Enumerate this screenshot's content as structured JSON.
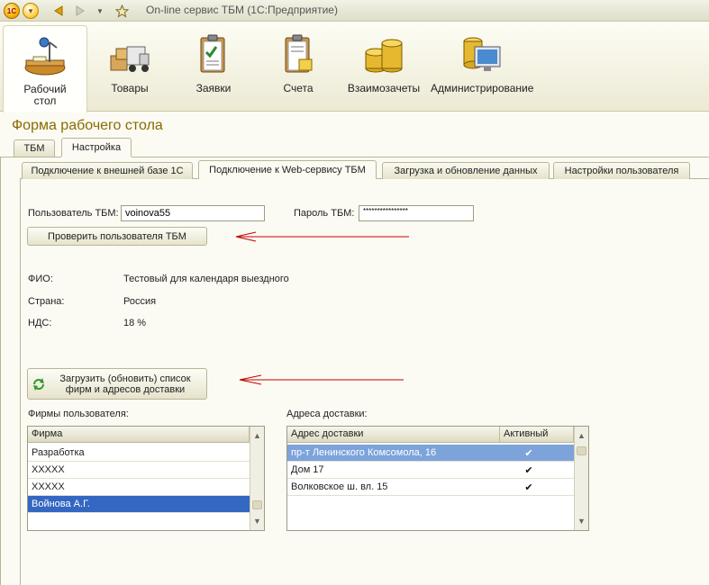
{
  "titlebar": {
    "title": "On-line сервис ТБМ  (1С:Предприятие)",
    "logo": "1С",
    "icons": [
      "1c-logo-icon",
      "main-menu-icon",
      "back-arrow-icon",
      "forward-arrow-icon",
      "dropdown-icon",
      "favorite-star-icon"
    ]
  },
  "sections": [
    {
      "label": "Рабочий\nстол",
      "icon": "desktop-icon"
    },
    {
      "label": "Товары",
      "icon": "goods-truck-icon"
    },
    {
      "label": "Заявки",
      "icon": "orders-clipboard-icon"
    },
    {
      "label": "Счета",
      "icon": "invoices-clipboard-icon"
    },
    {
      "label": "Взаимозачеты",
      "icon": "coins-icon"
    },
    {
      "label": "Администрирование",
      "icon": "monitor-database-icon"
    }
  ],
  "form": {
    "title": "Форма рабочего стола",
    "tabs": [
      "ТБМ",
      "Настройка"
    ],
    "subtabs": [
      "Подключение к внешней базе 1С",
      "Подключение к Web-сервису ТБМ",
      "Загрузка и обновление данных",
      "Настройки пользователя"
    ]
  },
  "connection": {
    "user_label": "Пользователь ТБМ:",
    "user_value": "voinova55",
    "password_label": "Пароль ТБМ:",
    "password_value": "****************",
    "check_button": "Проверить пользователя ТБМ",
    "fio_label": "ФИО:",
    "fio_value": "Тестовый для календаря выездного",
    "country_label": "Страна:",
    "country_value": "Россия",
    "vat_label": "НДС:",
    "vat_value": "18 %",
    "load_button": "Загрузить (обновить) список\nфирм и адресов доставки"
  },
  "firms": {
    "label": "Фирмы пользователя:",
    "column": "Фирма",
    "rows": [
      "Разработка",
      "XXXXX",
      "XXXXX",
      "Войнова А.Г."
    ]
  },
  "addresses": {
    "label": "Адреса доставки:",
    "columns": [
      "Адрес доставки",
      "Активный"
    ],
    "rows": [
      {
        "address": "пр-т Ленинского Комсомола, 16",
        "active": "✔"
      },
      {
        "address": "Дом 17",
        "active": "✔"
      },
      {
        "address": "Волковское ш. вл. 15",
        "active": "✔"
      }
    ]
  },
  "colors": {
    "selection": "#3467c2",
    "title": "#8a6a00",
    "arrow": "#c40000"
  }
}
